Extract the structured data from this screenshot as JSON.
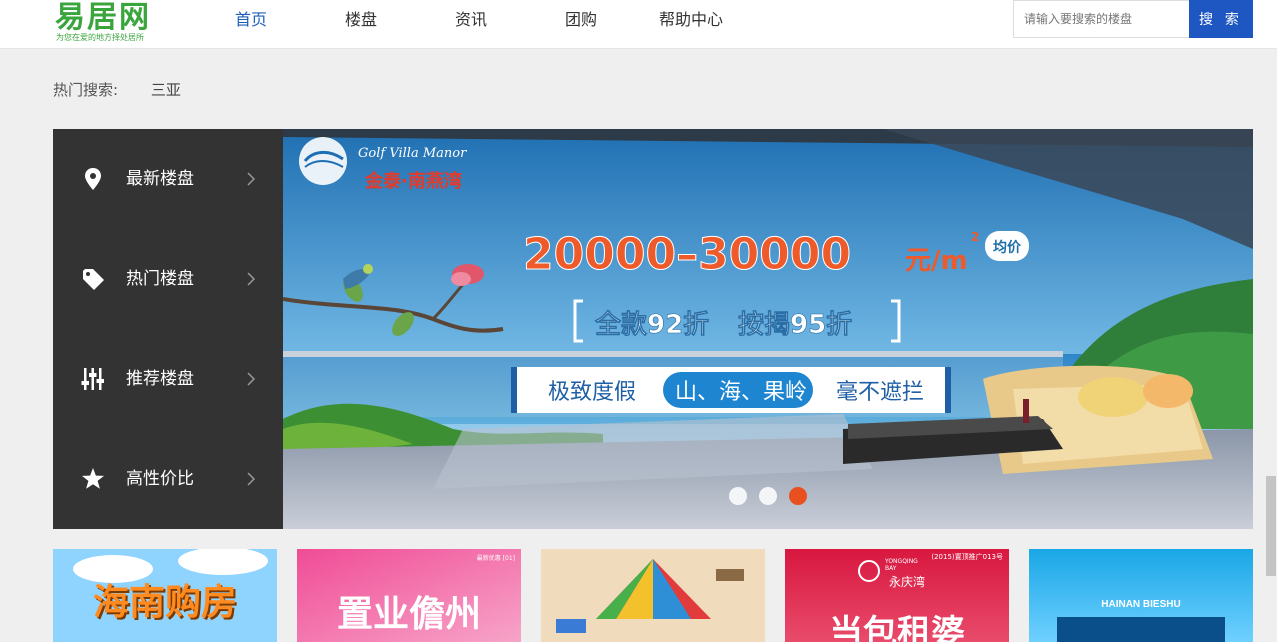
{
  "logo": {
    "text": "易居网",
    "tagline": "为您在爱的地方择处居所"
  },
  "nav": [
    {
      "label": "首页",
      "active": true
    },
    {
      "label": "楼盘",
      "active": false
    },
    {
      "label": "资讯",
      "active": false
    },
    {
      "label": "团购",
      "active": false
    },
    {
      "label": "帮助中心",
      "active": false
    }
  ],
  "search": {
    "placeholder": "请输入要搜索的楼盘",
    "button_label": "搜 索"
  },
  "hot_search": {
    "label": "热门搜索:",
    "links": [
      "三亚"
    ]
  },
  "sidebar": [
    {
      "label": "最新楼盘",
      "icon": "map-pin-icon"
    },
    {
      "label": "热门楼盘",
      "icon": "tag-icon"
    },
    {
      "label": "推荐楼盘",
      "icon": "sliders-icon"
    },
    {
      "label": "高性价比",
      "icon": "star-icon"
    }
  ],
  "banner": {
    "brand_script": "Golf Villa Manor",
    "brand_name": "金泰·南燕湾",
    "price_range": "20000–30000",
    "price_unit": "元/m",
    "price_unit_sup": "2",
    "price_badge": "均价",
    "discount_a": "全款92折",
    "discount_b": "按揭95折",
    "slogan_left": "极致度假",
    "slogan_mid": "山、海、果岭",
    "slogan_right": "毫不遮拦",
    "slides": 3,
    "active_slide": 3
  },
  "cards": [
    {
      "text": "海南购房",
      "color_top": "#8fd3ff",
      "color_bottom": "#d6f0ff",
      "text_color": "#ff8a1f"
    },
    {
      "text": "置业儋州",
      "color_top": "#f04c96",
      "color_bottom": "#f7a4c8",
      "text_color": "#ffffff",
      "small": "最新优惠 [01]"
    },
    {
      "text": "",
      "color_top": "#e9c9a0",
      "color_bottom": "#f3e3c8",
      "text_color": "#333333"
    },
    {
      "text": "当包租婆",
      "color_top": "#d8173f",
      "color_bottom": "#e94b6b",
      "text_color": "#ffffff",
      "small": "(2015)置顶推广013号",
      "logo_en": "YONGQING BAY",
      "logo_cn": "永庆湾"
    },
    {
      "text": "HAINAN BIESHU",
      "color_top": "#19a7e6",
      "color_bottom": "#6fd0ff",
      "text_color": "#ffffff"
    }
  ]
}
